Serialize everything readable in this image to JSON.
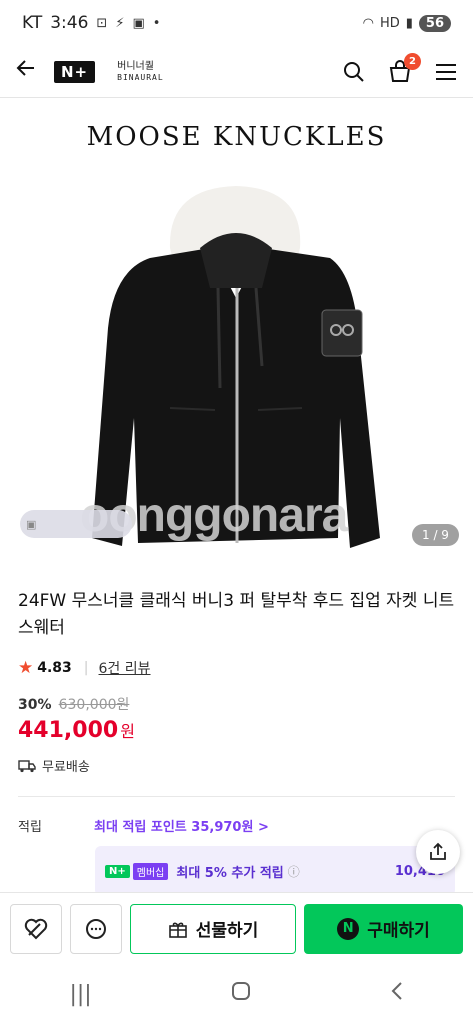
{
  "status_bar": {
    "carrier": "KT",
    "time": "3:46",
    "battery": "56",
    "network": "HD"
  },
  "header": {
    "back_icon": "arrow-left-icon",
    "nplus_label": "N+",
    "store_name": "버니너퀄",
    "store_sub": "BINAURAL",
    "cart_count": "2"
  },
  "product_image": {
    "brand_logo": "MOOSE KNUCKLES",
    "watermark": "oonggonara",
    "counter": "1 / 9",
    "colors": {
      "jacket": "#111111",
      "lining": "#f2f0ec",
      "hanger": "#e8a868"
    }
  },
  "product": {
    "title": "24FW 무스너클 클래식 버니3 퍼 탈부착 후드 집업 자켓 니트 스웨터",
    "rating": "4.83",
    "reviews": "6건 리뷰",
    "discount": "30%",
    "original_price": "630,000원",
    "final_price": "441,000",
    "currency": "원",
    "shipping": "무료배송"
  },
  "points": {
    "label": "적립",
    "max_points": "최대 적립 포인트 35,970원 >",
    "member_n": "N+",
    "member_tag": "멤버십",
    "member_text": "최대 5% 추가 적립",
    "member_amount": "10,410"
  },
  "actions": {
    "gift_label": "선물하기",
    "buy_label": "구매하기",
    "buy_badge": "N"
  },
  "colors": {
    "accent_green": "#03c75a",
    "price_red": "#e4002b",
    "points_purple": "#7b3ff2",
    "badge_orange": "#f04d2f"
  }
}
